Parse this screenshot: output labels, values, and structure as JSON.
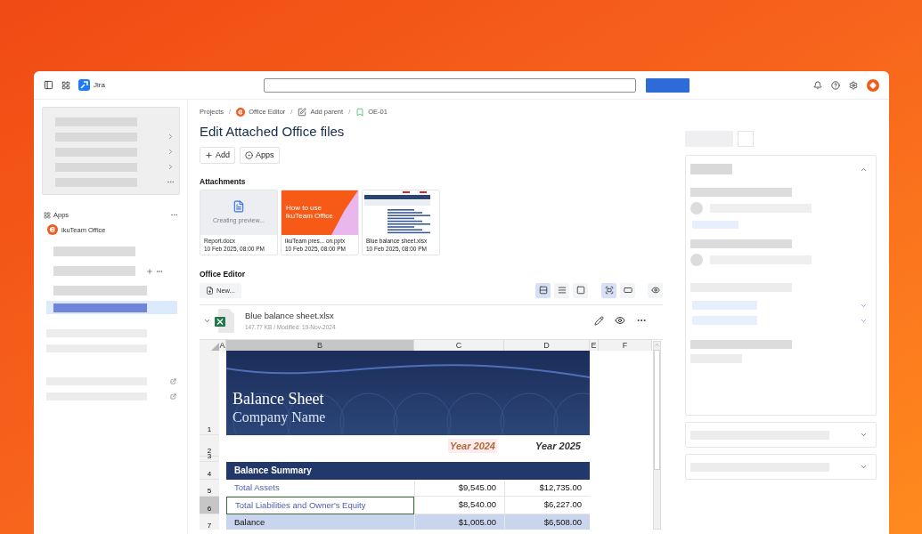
{
  "topbar": {
    "app_name": "Jira"
  },
  "sidebar": {
    "apps_heading": "Apps",
    "apps": [
      {
        "label": "ikuTeam Office"
      }
    ]
  },
  "breadcrumbs": [
    {
      "label": "Projects",
      "kind": "text"
    },
    {
      "label": "Office Editor",
      "kind": "app",
      "separator": "/"
    },
    {
      "label": "Add parent",
      "kind": "edit",
      "separator": "/"
    },
    {
      "label": "OE-01",
      "kind": "issue",
      "separator": "/"
    }
  ],
  "title": "Edit Attached Office files",
  "actions": [
    {
      "label": "Add",
      "kind": "add"
    },
    {
      "label": "Apps",
      "kind": "apps"
    }
  ],
  "attachments": {
    "heading": "Attachments",
    "items": [
      {
        "kind": "doc",
        "preview": "Creating preview...",
        "name": "Report.docx",
        "date": "10 Feb 2025, 08:00 PM"
      },
      {
        "kind": "slides",
        "preview": "How to use ikuTeam Office",
        "name": "ikuTeam pres...  on.pptx",
        "date": "10 Feb 2025, 08:00 PM"
      },
      {
        "kind": "sheet",
        "name": "Blue balance sheet.xlsx",
        "date": "10 Feb 2025, 08:00 PM"
      }
    ]
  },
  "office_editor": {
    "heading": "Office Editor",
    "new_button": "New...",
    "layout_buttons": [
      {
        "kind": "rows",
        "selected": true
      },
      {
        "kind": "list",
        "selected": false
      },
      {
        "kind": "single",
        "selected": false
      }
    ],
    "size_buttons": [
      {
        "kind": "fit",
        "selected": true
      },
      {
        "kind": "width",
        "selected": false
      }
    ],
    "file": {
      "name": "Blue balance sheet.xlsx",
      "meta": "147.77 KB / Modified: 19-Nov-2024",
      "expanded": true
    }
  },
  "sheet": {
    "columns": [
      {
        "label": "A",
        "selected": false
      },
      {
        "label": "B",
        "selected": true
      },
      {
        "label": "C",
        "selected": false
      },
      {
        "label": "D",
        "selected": false
      },
      {
        "label": "E",
        "selected": false
      },
      {
        "label": "F",
        "selected": false
      }
    ],
    "row_numbers": [
      {
        "label": "1",
        "selected": false
      },
      {
        "label": "2",
        "selected": false
      },
      {
        "label": "3",
        "selected": false
      },
      {
        "label": "4",
        "selected": false
      },
      {
        "label": "5",
        "selected": false
      },
      {
        "label": "6",
        "selected": true
      },
      {
        "label": "7",
        "selected": false
      }
    ],
    "banner": {
      "title": "Balance Sheet",
      "subtitle": "Company Name"
    },
    "years": [
      {
        "label": "Year 2024",
        "highlighted": true
      },
      {
        "label": "Year 2025",
        "highlighted": false
      }
    ],
    "summary_heading": "Balance Summary",
    "lines": [
      {
        "label": "Total Assets",
        "values": [
          "$9,545.00",
          "$12,735.00"
        ],
        "kind": "item",
        "selected": false
      },
      {
        "label": "Total Liabilities and Owner's Equity",
        "values": [
          "$8,540.00",
          "$6,227.00"
        ],
        "kind": "item",
        "selected": true
      },
      {
        "label": "Balance",
        "values": [
          "$1,005.00",
          "$6,508.00"
        ],
        "kind": "total",
        "selected": false
      }
    ]
  }
}
